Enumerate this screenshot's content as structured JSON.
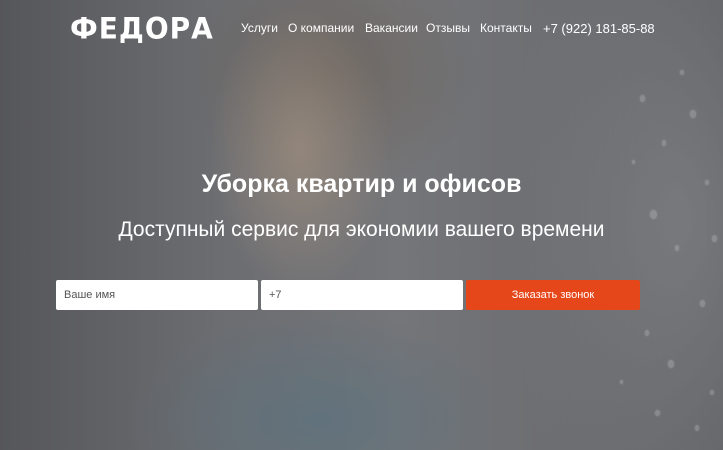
{
  "header": {
    "logo": "ФЕДОРА",
    "nav": [
      "Услуги",
      "О компании",
      "Вакансии",
      "Отзывы",
      "Контакты"
    ],
    "phone": "+7 (922) 181-85-88"
  },
  "hero": {
    "title": "Уборка квартир и офисов",
    "subtitle": "Доступный сервис для экономии вашего времени"
  },
  "form": {
    "name_placeholder": "Ваше имя",
    "phone_placeholder": "+7",
    "submit_label": "Заказать звонок"
  },
  "colors": {
    "accent": "#e5461a",
    "text": "#ffffff"
  }
}
